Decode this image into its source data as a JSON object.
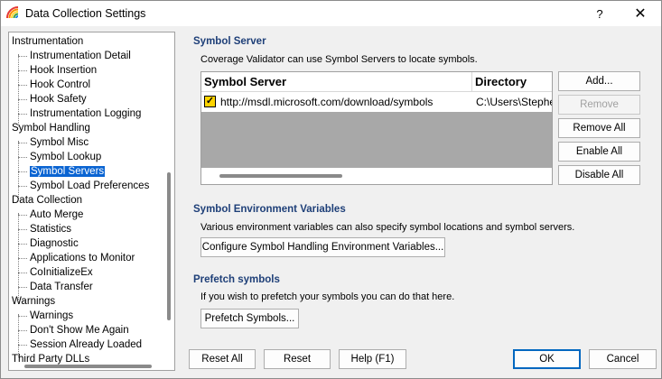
{
  "window": {
    "title": "Data Collection Settings",
    "help_label": "?",
    "close_label": "✕"
  },
  "tree": {
    "items": [
      {
        "label": "Instrumentation",
        "level": 0
      },
      {
        "label": "Instrumentation Detail",
        "level": 1
      },
      {
        "label": "Hook Insertion",
        "level": 1
      },
      {
        "label": "Hook Control",
        "level": 1
      },
      {
        "label": "Hook Safety",
        "level": 1
      },
      {
        "label": "Instrumentation Logging",
        "level": 1
      },
      {
        "label": "Symbol Handling",
        "level": 0
      },
      {
        "label": "Symbol Misc",
        "level": 1
      },
      {
        "label": "Symbol Lookup",
        "level": 1
      },
      {
        "label": "Symbol Servers",
        "level": 1,
        "selected": true
      },
      {
        "label": "Symbol Load Preferences",
        "level": 1
      },
      {
        "label": "Data Collection",
        "level": 0
      },
      {
        "label": "Auto Merge",
        "level": 1
      },
      {
        "label": "Statistics",
        "level": 1
      },
      {
        "label": "Diagnostic",
        "level": 1
      },
      {
        "label": "Applications to Monitor",
        "level": 1
      },
      {
        "label": "CoInitializeEx",
        "level": 1
      },
      {
        "label": "Data Transfer",
        "level": 1
      },
      {
        "label": "Warnings",
        "level": 0
      },
      {
        "label": "Warnings",
        "level": 1
      },
      {
        "label": "Don't Show Me Again",
        "level": 1
      },
      {
        "label": "Session Already Loaded",
        "level": 1
      },
      {
        "label": "Third Party DLLs",
        "level": 0
      }
    ]
  },
  "symbol_server": {
    "title": "Symbol Server",
    "description": "Coverage Validator can use Symbol Servers to locate symbols.",
    "columns": [
      "Symbol Server",
      "Directory"
    ],
    "rows": [
      {
        "checked": true,
        "server": "http://msdl.microsoft.com/download/symbols",
        "directory": "C:\\Users\\Stephe"
      }
    ],
    "buttons": {
      "add": "Add...",
      "remove": "Remove",
      "remove_all": "Remove All",
      "enable_all": "Enable All",
      "disable_all": "Disable All"
    }
  },
  "env_vars": {
    "title": "Symbol Environment Variables",
    "description": "Various environment variables can also specify symbol locations and symbol servers.",
    "button": "Configure Symbol Handling Environment Variables..."
  },
  "prefetch": {
    "title": "Prefetch symbols",
    "description": "If you wish to prefetch your symbols you can do that here.",
    "button": "Prefetch Symbols..."
  },
  "footer": {
    "reset_all": "Reset All",
    "reset": "Reset",
    "help": "Help (F1)",
    "ok": "OK",
    "cancel": "Cancel"
  }
}
